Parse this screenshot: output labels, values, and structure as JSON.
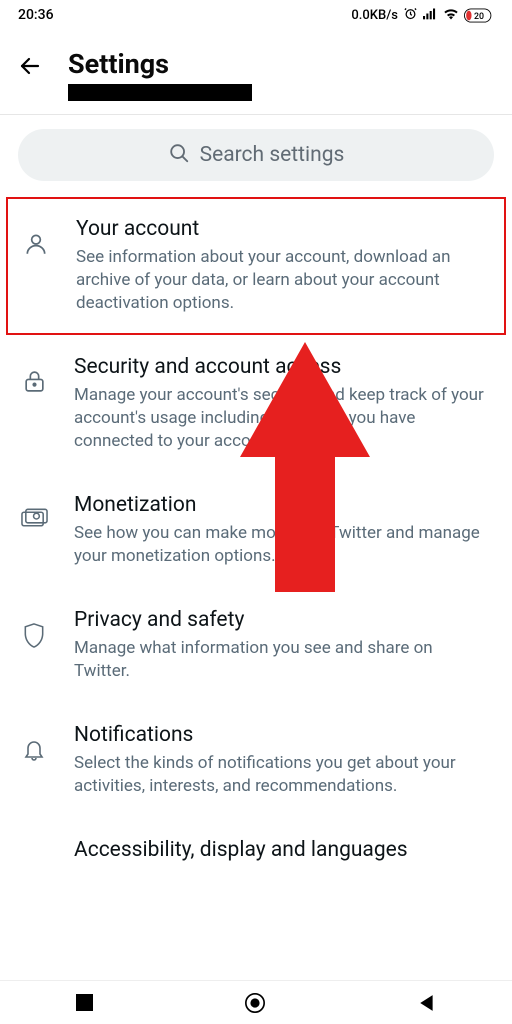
{
  "status": {
    "time": "20:36",
    "net": "0.0KB/s",
    "battery": "20"
  },
  "header": {
    "title": "Settings"
  },
  "search": {
    "placeholder": "Search settings"
  },
  "items": [
    {
      "title": "Your account",
      "desc": "See information about your account, download an archive of your data, or learn about your account deactivation options."
    },
    {
      "title": "Security and account access",
      "desc": "Manage your account's security and keep track of your account's usage including apps that you have connected to your account."
    },
    {
      "title": "Monetization",
      "desc": "See how you can make money on Twitter and manage your monetization options."
    },
    {
      "title": "Privacy and safety",
      "desc": "Manage what information you see and share on Twitter."
    },
    {
      "title": "Notifications",
      "desc": "Select the kinds of notifications you get about your activities, interests, and recommendations."
    },
    {
      "title": "Accessibility, display and languages",
      "desc": ""
    }
  ]
}
